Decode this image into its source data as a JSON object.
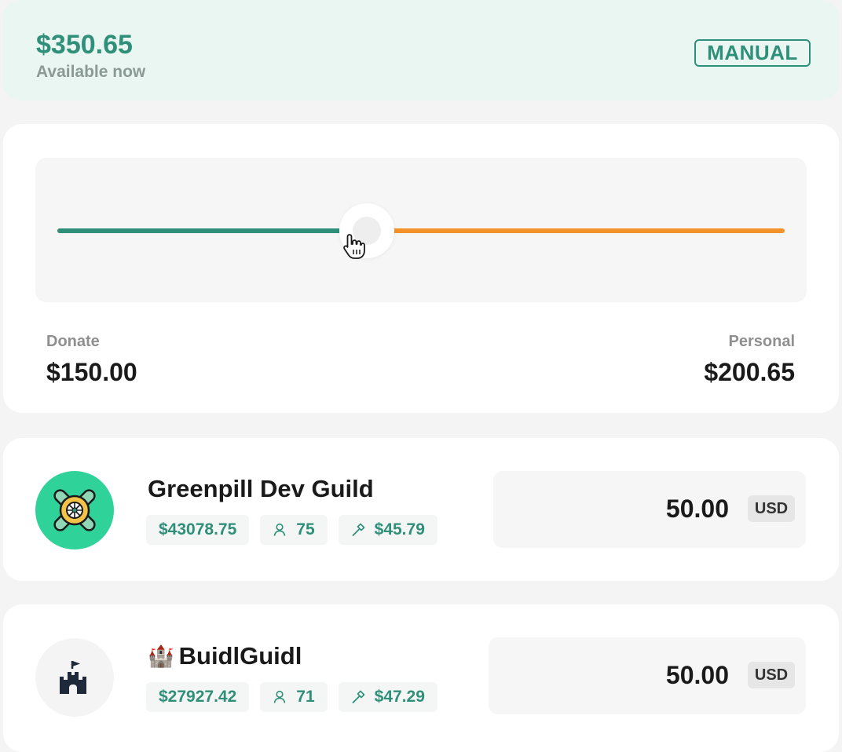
{
  "balance": {
    "amount": "$350.65",
    "caption": "Available now",
    "mode": "MANUAL"
  },
  "split": {
    "donate_label": "Donate",
    "donate_value": "$150.00",
    "personal_label": "Personal",
    "personal_value": "$200.65",
    "slider_fraction": 0.426,
    "colors": {
      "donate": "#2f8f78",
      "personal": "#f29228"
    }
  },
  "projects": [
    {
      "name": "Greenpill Dev Guild",
      "name_prefix": "",
      "icon": "greenpill-logo-icon",
      "stats": {
        "raised": "$43078.75",
        "contributors": "75",
        "average": "$45.79"
      },
      "amount": "50.00",
      "currency": "USD"
    },
    {
      "name": "BuidlGuidl",
      "name_prefix": "🏰",
      "icon": "castle-icon",
      "stats": {
        "raised": "$27927.42",
        "contributors": "71",
        "average": "$47.29"
      },
      "amount": "50.00",
      "currency": "USD"
    }
  ]
}
